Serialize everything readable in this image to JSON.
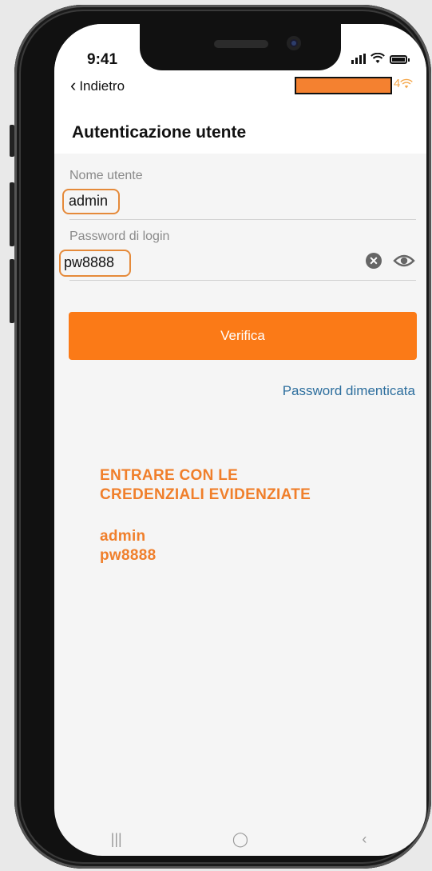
{
  "status_bar": {
    "time": "9:41"
  },
  "header": {
    "back_label": "Indietro",
    "back_chevron": "‹",
    "network_suffix": "4"
  },
  "page": {
    "title": "Autenticazione utente"
  },
  "form": {
    "username": {
      "label": "Nome utente",
      "value": "admin"
    },
    "password": {
      "label": "Password di login",
      "value": "pw8888",
      "clear_glyph": "✕"
    },
    "verify_button": "Verifica",
    "forgot_link": "Password dimenticata"
  },
  "instructions": {
    "line1": "ENTRARE CON LE",
    "line2": "CREDENZIALI EVIDENZIATE",
    "user": "admin",
    "pass": "pw8888"
  },
  "nav_bar": {
    "recents": "|||",
    "home": "◯",
    "back": "‹"
  },
  "colors": {
    "accent": "#fb7a17",
    "link": "#2e6f9e",
    "highlight": "#e58a3a"
  },
  "icons": [
    "chevron-left-icon",
    "wifi-icon",
    "signal-icon",
    "battery-icon",
    "clear-icon",
    "eye-icon",
    "redacted-block"
  ]
}
